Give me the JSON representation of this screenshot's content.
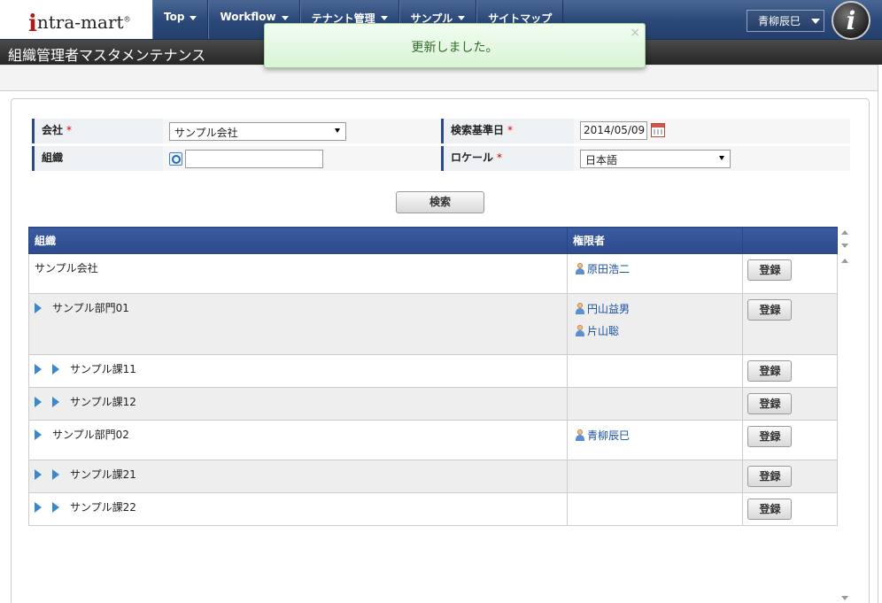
{
  "header": {
    "logo": "intra-mart",
    "nav": [
      {
        "label": "Top",
        "dropdown": true
      },
      {
        "label": "Workflow",
        "dropdown": true
      },
      {
        "label": "テナント管理",
        "dropdown": true
      },
      {
        "label": "サンプル",
        "dropdown": true
      },
      {
        "label": "サイトマップ",
        "dropdown": false
      }
    ],
    "user": "青柳辰巳",
    "info_icon": "i"
  },
  "page": {
    "title": "組織管理者マスタメンテナンス"
  },
  "toast": {
    "message": "更新しました。",
    "close": "×"
  },
  "form": {
    "company_label": "会社",
    "company_value": "サンプル会社",
    "date_label": "検索基準日",
    "date_value": "2014/05/09",
    "org_label": "組織",
    "org_value": "",
    "locale_label": "ロケール",
    "locale_value": "日本語",
    "required_mark": "*",
    "search_button": "検索"
  },
  "table": {
    "headers": [
      "組織",
      "権限者",
      ""
    ],
    "rows": [
      {
        "depth": 0,
        "name": "サンプル会社",
        "managers": [
          "原田浩二"
        ],
        "button": "登録"
      },
      {
        "depth": 1,
        "name": "サンプル部門01",
        "managers": [
          "円山益男",
          "片山聡"
        ],
        "button": "登録"
      },
      {
        "depth": 2,
        "name": "サンプル課11",
        "managers": [],
        "button": "登録"
      },
      {
        "depth": 2,
        "name": "サンプル課12",
        "managers": [],
        "button": "登録"
      },
      {
        "depth": 1,
        "name": "サンプル部門02",
        "managers": [
          "青柳辰巳"
        ],
        "button": "登録"
      },
      {
        "depth": 2,
        "name": "サンプル課21",
        "managers": [],
        "button": "登録"
      },
      {
        "depth": 2,
        "name": "サンプル課22",
        "managers": [],
        "button": "登録"
      }
    ]
  },
  "colors": {
    "nav_blue": "#2c4a7a",
    "header_blue": "#2d4b8d",
    "tree_arrow": "#3a86d0",
    "link": "#1a4fa0",
    "required": "#dd0000"
  }
}
